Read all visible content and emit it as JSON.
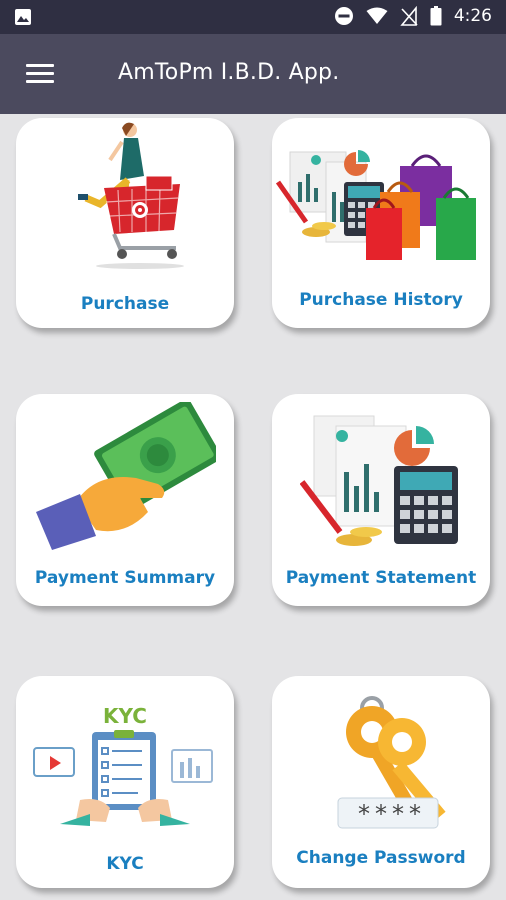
{
  "status_bar": {
    "time": "4:26",
    "icons": [
      "image-notification-icon",
      "do-not-disturb-icon",
      "wifi-icon",
      "no-signal-icon",
      "battery-icon"
    ]
  },
  "app_bar": {
    "title": "AmToPm I.B.D. App.",
    "menu_icon": "hamburger-menu-icon"
  },
  "menu_cards": [
    {
      "label": "Purchase",
      "icon": "shopping-cart-woman-icon"
    },
    {
      "label": "Purchase History",
      "icon": "shopping-bags-receipts-icon"
    },
    {
      "label": "Payment Summary",
      "icon": "hand-with-cash-icon"
    },
    {
      "label": "Payment Statement",
      "icon": "statement-calculator-icon"
    },
    {
      "label": "KYC",
      "icon": "kyc-clipboard-icon"
    },
    {
      "label": "Change Password",
      "icon": "keys-password-icon"
    }
  ],
  "kyc_image_text": "KYC",
  "password_mask": "****",
  "colors": {
    "status_bar": "#2f2f42",
    "app_bar": "#4b4a5e",
    "background": "#e4e4e6",
    "card_label": "#1a7fc0",
    "card": "#ffffff"
  }
}
